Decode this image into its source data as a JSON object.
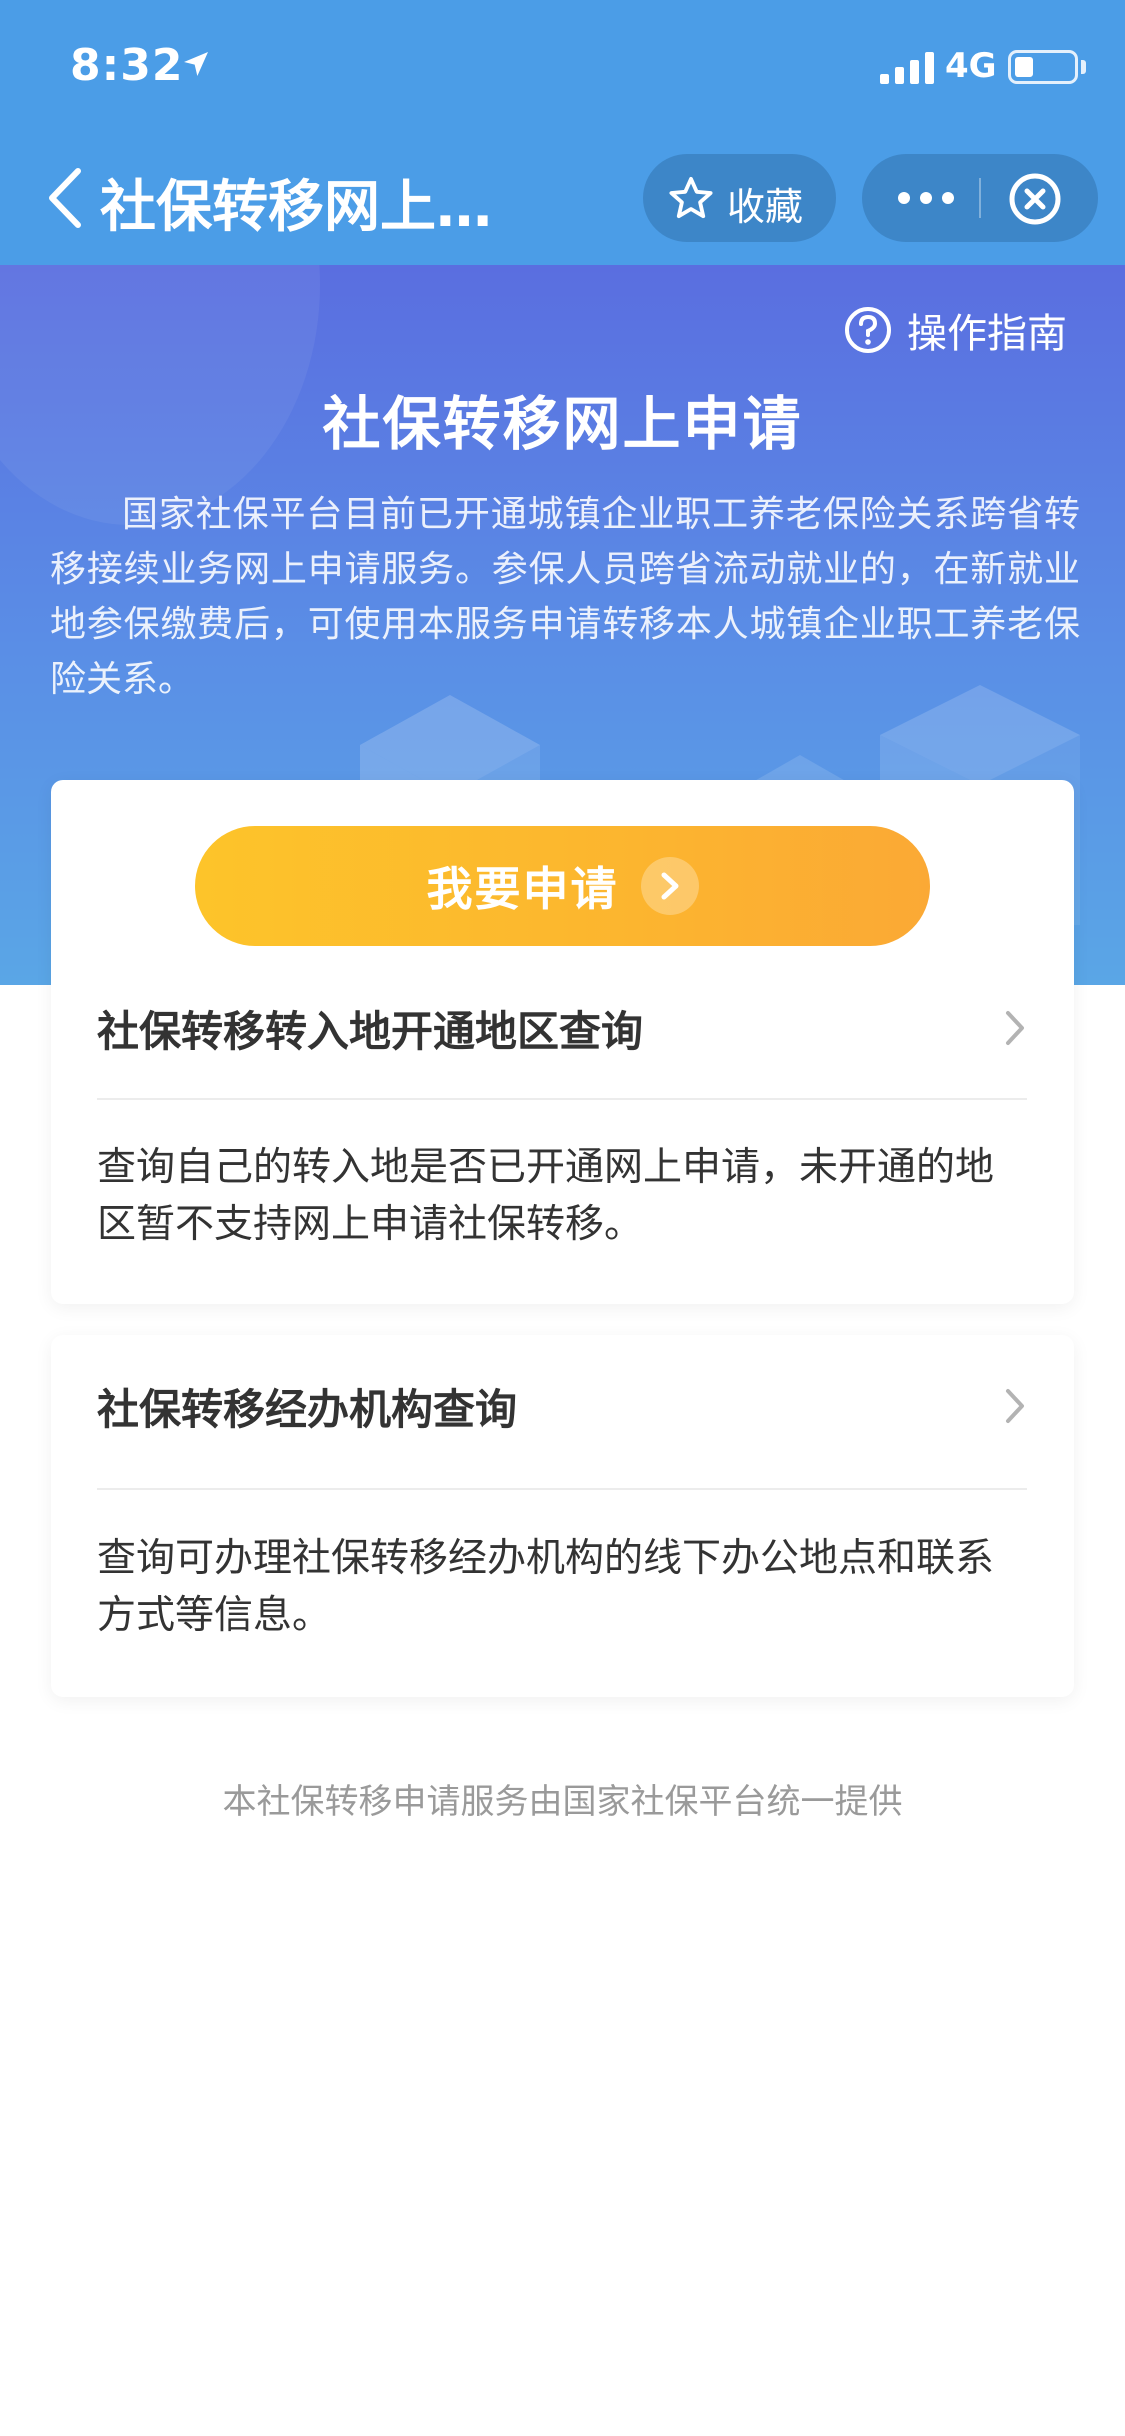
{
  "status_bar": {
    "time": "8:32",
    "network": "4G",
    "location_icon": "location-arrow-icon",
    "signal_icon": "signal-bars-icon",
    "battery_icon": "battery-low-icon"
  },
  "nav": {
    "back_icon": "chevron-left-icon",
    "title": "社保转移网上…",
    "favorite_icon": "star-outline-icon",
    "favorite_label": "收藏",
    "more_icon": "more-dots-icon",
    "close_icon": "close-circle-icon"
  },
  "hero": {
    "guide_icon": "question-circle-icon",
    "guide_label": "操作指南",
    "title": "社保转移网上申请",
    "description": "国家社保平台目前已开通城镇企业职工养老保险关系跨省转移接续业务网上申请服务。参保人员跨省流动就业的，在新就业地参保缴费后，可使用本服务申请转移本人城镇企业职工养老保险关系。"
  },
  "apply": {
    "label": "我要申请",
    "arrow_icon": "chevron-right-circle-icon"
  },
  "cards": [
    {
      "title": "社保转移转入地开通地区查询",
      "description": "查询自己的转入地是否已开通网上申请，未开通的地区暂不支持网上申请社保转移。",
      "chevron_icon": "chevron-right-icon"
    },
    {
      "title": "社保转移经办机构查询",
      "description": "查询可办理社保转移经办机构的线下办公地点和联系方式等信息。",
      "chevron_icon": "chevron-right-icon"
    }
  ],
  "footer": {
    "note": "本社保转移申请服务由国家社保平台统一提供"
  },
  "colors": {
    "nav_blue": "#4b9de7",
    "capsule_blue": "#3d86c8",
    "hero_top": "#5a6ee0",
    "hero_bottom": "#5aa6e6",
    "apply_gradient_start": "#fdc42a",
    "apply_gradient_end": "#fba935",
    "footer_gray": "#9a9a9a"
  }
}
